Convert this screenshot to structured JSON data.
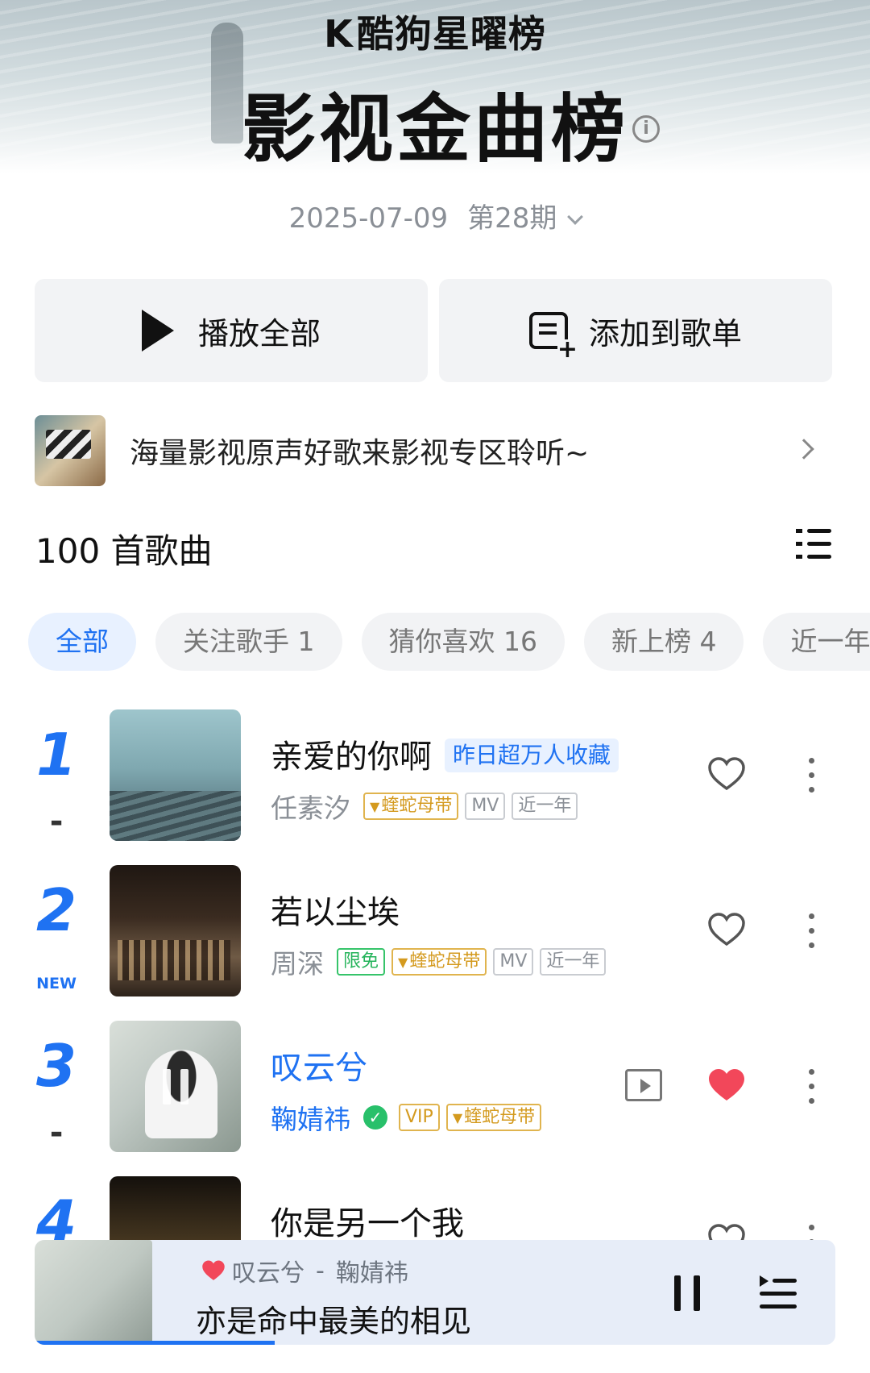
{
  "header": {
    "brand": "酷狗星曜榜",
    "brand_logo": "K",
    "title": "影视金曲榜",
    "date": "2025-07-09",
    "issue": "第28期"
  },
  "actions": {
    "play_all": "播放全部",
    "add_to_playlist": "添加到歌单"
  },
  "promo": {
    "text": "海量影视原声好歌来影视专区聆听~"
  },
  "list": {
    "count_label": "100 首歌曲"
  },
  "filters": [
    {
      "label": "全部",
      "active": true
    },
    {
      "label": "关注歌手 1",
      "active": false
    },
    {
      "label": "猜你喜欢 16",
      "active": false
    },
    {
      "label": "新上榜 4",
      "active": false
    },
    {
      "label": "近一年",
      "active": false
    }
  ],
  "songs": [
    {
      "rank": "1",
      "trend": "-",
      "title": "亲爱的你啊",
      "badge": "昨日超万人收藏",
      "artist": "任素汐",
      "tags": [
        "蝰蛇母带",
        "MV",
        "近一年"
      ],
      "liked": false
    },
    {
      "rank": "2",
      "trend": "NEW",
      "title": "若以尘埃",
      "artist": "周深",
      "tags": [
        "限免",
        "蝰蛇母带",
        "MV",
        "近一年"
      ],
      "liked": false
    },
    {
      "rank": "3",
      "trend": "-",
      "title": "叹云兮",
      "artist": "鞠婧祎",
      "tags": [
        "VIP",
        "蝰蛇母带"
      ],
      "liked": true,
      "playing": true
    },
    {
      "rank": "4",
      "trend": "",
      "title": "你是另一个我",
      "artist": "",
      "tags": [],
      "liked": false
    }
  ],
  "player": {
    "song": "叹云兮",
    "separator": "-",
    "artist": "鞠婧祎",
    "lyric": "亦是命中最美的相见",
    "progress": 0.3
  },
  "colors": {
    "accent": "#1f72f2",
    "liked": "#f2475a",
    "gold_tag": "#d49a1e",
    "green_tag": "#24b35a"
  }
}
